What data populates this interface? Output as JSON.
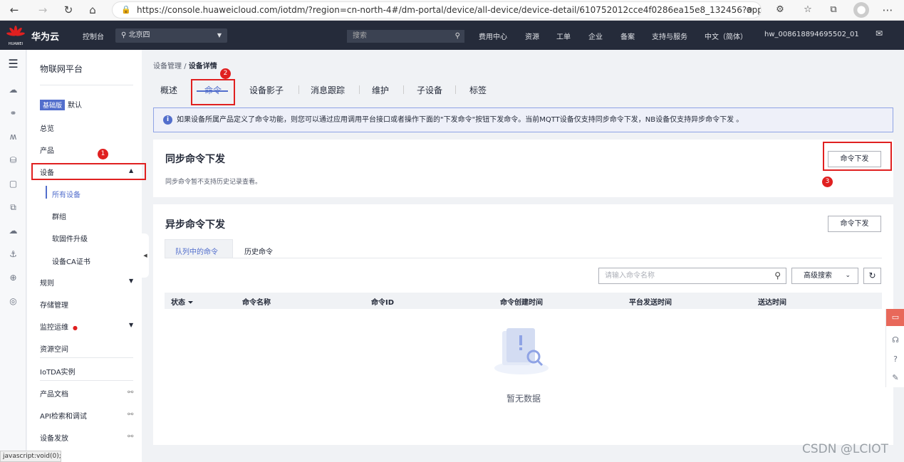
{
  "browser": {
    "url": "https://console.huaweicloud.com/iotdm/?region=cn-north-4#/dm-portal/device/all-device/device-detail/610752012cce4f0286ea15e8_132456?appId=868ad9..."
  },
  "topbar": {
    "logo_text": "HUAWEI",
    "brand": "华为云",
    "console": "控制台",
    "region": "北京四",
    "search_placeholder": "搜索",
    "links": [
      "费用中心",
      "资源",
      "工单",
      "企业",
      "备案",
      "支持与服务",
      "中文（简体）"
    ],
    "user": "hw_008618894695502_01"
  },
  "sidenav": {
    "title": "物联网平台",
    "edition_badge": "基础版",
    "edition_name": "默认",
    "overview": "总览",
    "product": "产品",
    "device": "设备",
    "device_subitems": [
      "所有设备",
      "群组",
      "软固件升级",
      "设备CA证书"
    ],
    "rules": "规则",
    "storage": "存储管理",
    "monitor": "监控运维",
    "resource_space": "资源空间",
    "iotda_instance": "IoTDA实例",
    "product_docs": "产品文档",
    "api_explorer": "API检索和调试",
    "device_provision": "设备发放"
  },
  "annotations": [
    "1",
    "2",
    "3"
  ],
  "breadcrumb": {
    "parent": "设备管理",
    "separator": "/",
    "current": "设备详情"
  },
  "tabs": [
    "概述",
    "命令",
    "设备影子",
    "消息跟踪",
    "维护",
    "子设备",
    "标签"
  ],
  "info_banner": "如果设备所属产品定义了命令功能，则您可以通过应用调用平台接口或者操作下面的\"下发命令\"按钮下发命令。当前MQTT设备仅支持同步命令下发，NB设备仅支持异步命令下发 。",
  "sync_section": {
    "title": "同步命令下发",
    "button": "命令下发",
    "hint": "同步命令暂不支持历史记录查看。"
  },
  "async_section": {
    "title": "异步命令下发",
    "button": "命令下发",
    "subtabs": [
      "队列中的命令",
      "历史命令"
    ],
    "search_placeholder": "请输入命令名称",
    "advanced_search": "高级搜索",
    "columns": [
      "状态",
      "命令名称",
      "命令ID",
      "命令创建时间",
      "平台发送时间",
      "送达时间"
    ],
    "empty_text": "暂无数据"
  },
  "statusbar": "javascript:void(0);",
  "watermark": "CSDN @LCIOT",
  "colors": {
    "accent": "#526ecc",
    "topbar": "#252b3a",
    "annotation_red": "#e02020",
    "float_active": "#e8685a"
  }
}
